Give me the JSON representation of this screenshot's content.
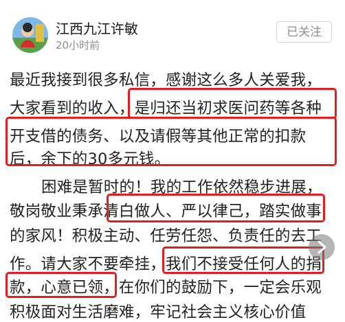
{
  "post": {
    "author_name": "江西九江许敏",
    "timestamp": "20小时前",
    "follow_label": "已关注"
  },
  "body": {
    "lines": [
      "最近我接到很多私信，感谢这么多人关爱我，",
      "大家看到的收入，是归还当初求医问药等各种",
      "开支借的债务、以及请假等其他正常的扣款",
      "后，余下的30多元钱。",
      "困难是暂时的！我的工作依然稳步进展，",
      "敬岗敬业秉承清白做人、严以律己，踏实做事",
      "的家风！积极主动、任劳任怨、负责任的去工",
      "作。请大家不要牵挂，我们不接受任何人的捐",
      "款，心意已领，在你们的鼓励下，一定会乐观",
      "积极面对生活磨难，牢记社会主义核心价值"
    ]
  },
  "colors": {
    "highlight_border": "#e11d1d",
    "timestamp": "#8c8c8c"
  },
  "icons": {
    "next": "chevron-right-icon"
  }
}
